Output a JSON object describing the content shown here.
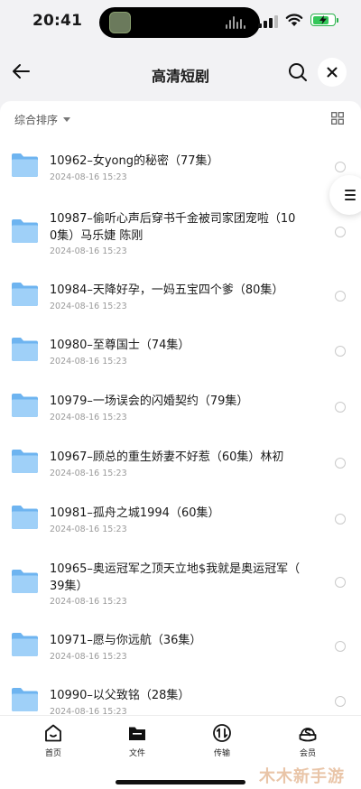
{
  "status_bar": {
    "time": "20:41"
  },
  "nav": {
    "title": "高清短剧"
  },
  "toolbar": {
    "sort_label": "综合排序"
  },
  "files": [
    {
      "name": "10962–女yong的秘密（77集）",
      "date": "2024-08-16 15:23"
    },
    {
      "name": "10987–偷听心声后穿书千金被司家团宠啦（10\n0集）马乐婕 陈刚",
      "date": "2024-08-16 15:23"
    },
    {
      "name": "10984–天降好孕，一妈五宝四个爹（80集）",
      "date": "2024-08-16 15:23"
    },
    {
      "name": "10980–至尊国士（74集）",
      "date": "2024-08-16 15:23"
    },
    {
      "name": "10979–一场误会的闪婚契约（79集）",
      "date": "2024-08-16 15:23"
    },
    {
      "name": "10967–顾总的重生娇妻不好惹（60集）林初",
      "date": "2024-08-16 15:23"
    },
    {
      "name": "10981–孤舟之城1994（60集）",
      "date": "2024-08-16 15:23"
    },
    {
      "name": "10965–奥运冠军之顶天立地$我就是奥运冠军（\n39集）",
      "date": "2024-08-16 15:23"
    },
    {
      "name": "10971–愿与你远航（36集）",
      "date": "2024-08-16 15:23"
    },
    {
      "name": "10990–以父致铭（28集）",
      "date": "2024-08-16 15:23"
    }
  ],
  "tabs": [
    {
      "label": "首页",
      "icon": "home-icon"
    },
    {
      "label": "文件",
      "icon": "folder-icon"
    },
    {
      "label": "传输",
      "icon": "transfer-icon"
    },
    {
      "label": "会员",
      "icon": "vip-icon"
    }
  ],
  "watermark": "木木新手游",
  "colors": {
    "folder": "#6eb4f0",
    "folder_light": "#9fd0f8",
    "battery": "#34c759"
  }
}
